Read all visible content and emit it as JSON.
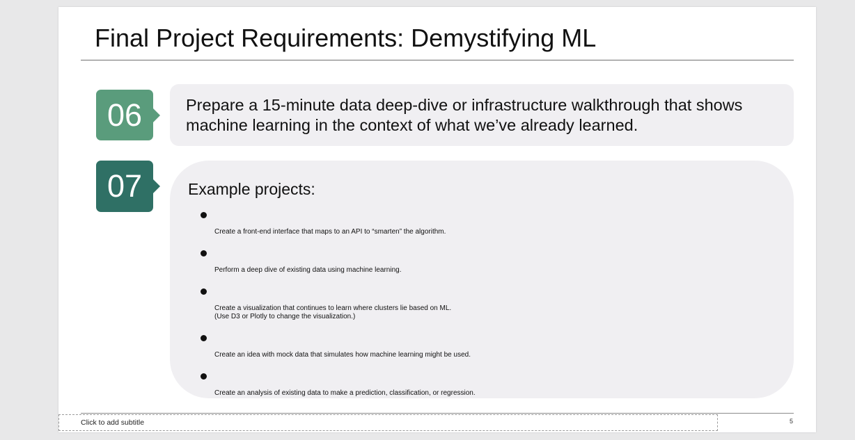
{
  "slide": {
    "title": "Final Project Requirements: Demystifying ML",
    "items": [
      {
        "number": "06",
        "text": "Prepare a 15-minute data deep-dive or infrastructure walkthrough that shows machine learning in the context of what we’ve already learned."
      },
      {
        "number": "07",
        "heading": "Example projects:",
        "bullets": [
          "Create a front-end interface that maps to an API to “smarten” the algorithm.",
          "Perform a deep dive of existing data using machine learning.",
          "Create a visualization that continues to learn where clusters lie based on ML.\n(Use D3 or Plotly to change the visualization.)",
          "Create an idea with mock data that simulates how machine learning might be used.",
          "Create an analysis of existing data to make a prediction, classification, or regression."
        ]
      }
    ],
    "subtitle_placeholder": "Click to add subtitle",
    "page_number": "5"
  },
  "colors": {
    "number_06": "#5a9c7c",
    "number_07": "#2f7065",
    "panel": "#f0eff2"
  }
}
